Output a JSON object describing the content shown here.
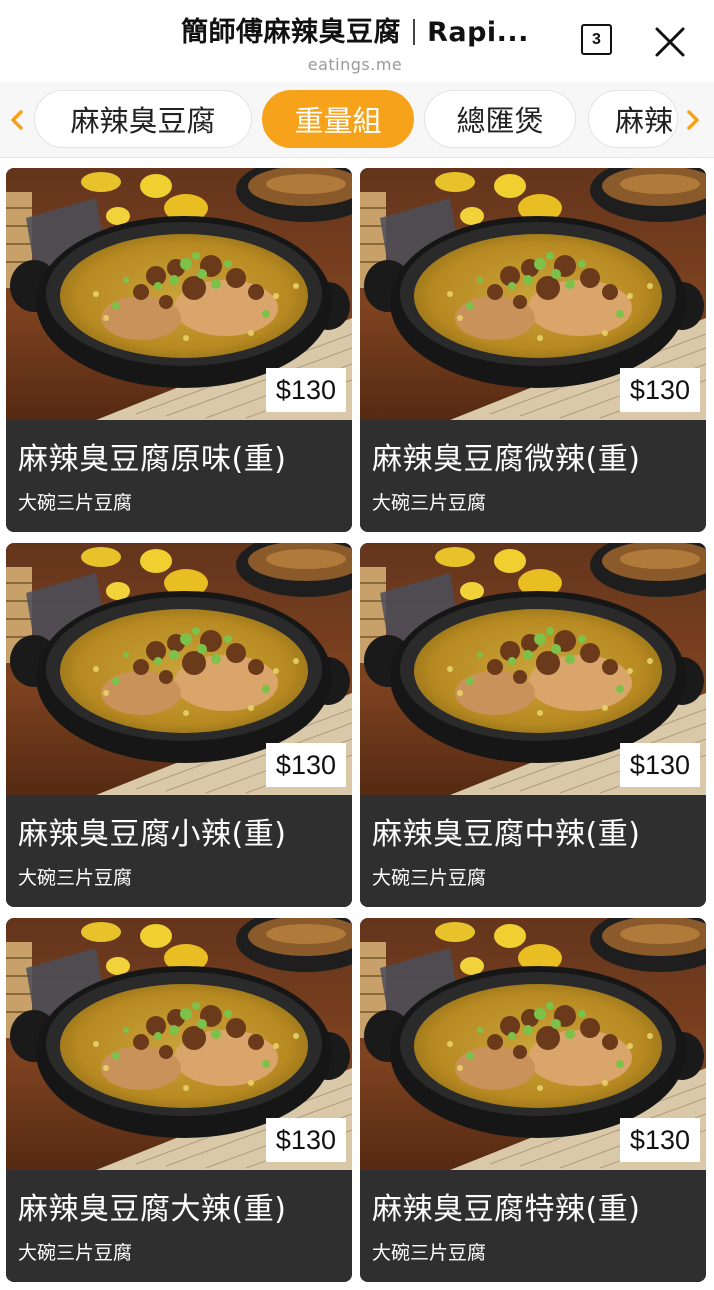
{
  "header": {
    "title": "簡師傅麻辣臭豆腐",
    "title_suffix": "Rapi...",
    "domain": "eatings.me",
    "tab_count": "3"
  },
  "categories": [
    {
      "label": "麻辣臭豆腐",
      "active": false
    },
    {
      "label": "重量組",
      "active": true
    },
    {
      "label": "總匯煲",
      "active": false
    },
    {
      "label": "麻辣",
      "active": false
    }
  ],
  "colors": {
    "accent": "#f7a21b",
    "card_bg": "#2f2f2f"
  },
  "products": [
    {
      "name": "麻辣臭豆腐原味(重)",
      "desc": "大碗三片豆腐",
      "price": "$130"
    },
    {
      "name": "麻辣臭豆腐微辣(重)",
      "desc": "大碗三片豆腐",
      "price": "$130"
    },
    {
      "name": "麻辣臭豆腐小辣(重)",
      "desc": "大碗三片豆腐",
      "price": "$130"
    },
    {
      "name": "麻辣臭豆腐中辣(重)",
      "desc": "大碗三片豆腐",
      "price": "$130"
    },
    {
      "name": "麻辣臭豆腐大辣(重)",
      "desc": "大碗三片豆腐",
      "price": "$130"
    },
    {
      "name": "麻辣臭豆腐特辣(重)",
      "desc": "大碗三片豆腐",
      "price": "$130"
    }
  ]
}
